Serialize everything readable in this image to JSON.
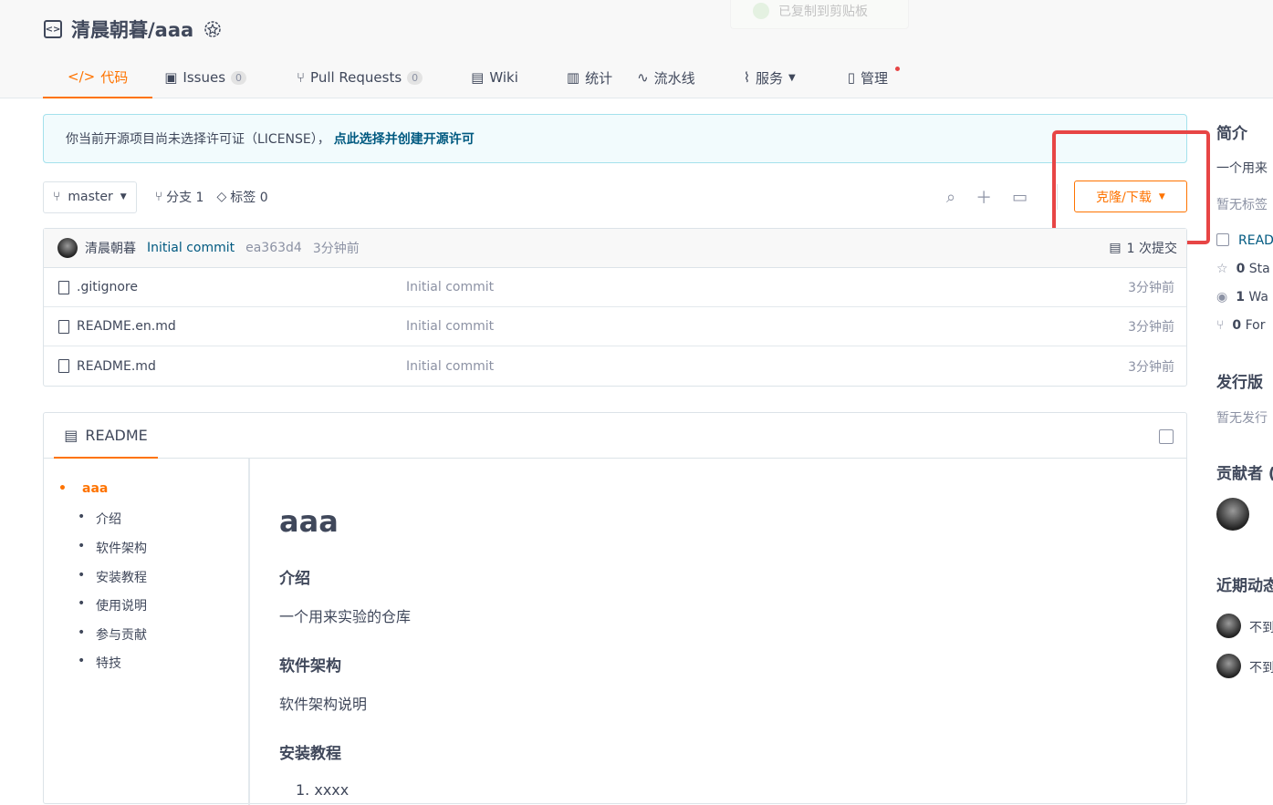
{
  "repo": {
    "name": "清晨朝暮/aaa",
    "toast_text": "已复制到剪贴板"
  },
  "tabs": [
    {
      "label": "代码"
    },
    {
      "label": "Issues",
      "count": "0"
    },
    {
      "label": "Pull Requests",
      "count": "0"
    },
    {
      "label": "Wiki"
    },
    {
      "label": "统计"
    },
    {
      "label": "流水线"
    },
    {
      "label": "服务"
    },
    {
      "label": "管理"
    }
  ],
  "license_notice": {
    "text": "你当前开源项目尚未选择许可证（LICENSE），",
    "link": "点此选择并创建开源许可"
  },
  "branchbar": {
    "branch": "master",
    "branches": "分支 1",
    "tags": "标签 0",
    "clone_label": "克隆/下载"
  },
  "commit": {
    "author": "清晨朝暮",
    "message": "Initial commit",
    "sha": "ea363d4",
    "time": "3分钟前",
    "commits": "1 次提交"
  },
  "files": [
    {
      "name": ".gitignore",
      "message": "Initial commit",
      "time": "3分钟前"
    },
    {
      "name": "README.en.md",
      "message": "Initial commit",
      "time": "3分钟前"
    },
    {
      "name": "README.md",
      "message": "Initial commit",
      "time": "3分钟前"
    }
  ],
  "readme": {
    "tab_label": "README",
    "toc_root": "aaa",
    "toc": [
      "介绍",
      "软件架构",
      "安装教程",
      "使用说明",
      "参与贡献",
      "特技"
    ],
    "title": "aaa",
    "s1_h": "介绍",
    "s1_p": "一个用来实验的仓库",
    "s2_h": "软件架构",
    "s2_p": "软件架构说明",
    "s3_h": "安装教程",
    "s3_item": "1. xxxx"
  },
  "sidebar": {
    "intro_h": "简介",
    "intro_text": "一个用来",
    "no_tags": "暂无标签",
    "readme_link": "READ",
    "stars": "0",
    "stars_label": "Sta",
    "watches": "1",
    "watches_label": "Wa",
    "forks": "0",
    "forks_label": "For",
    "release_h": "发行版",
    "no_release": "暂无发行",
    "contrib_h": "贡献者 (",
    "activity_h": "近期动态",
    "act1": "不到",
    "act2": "不到"
  }
}
